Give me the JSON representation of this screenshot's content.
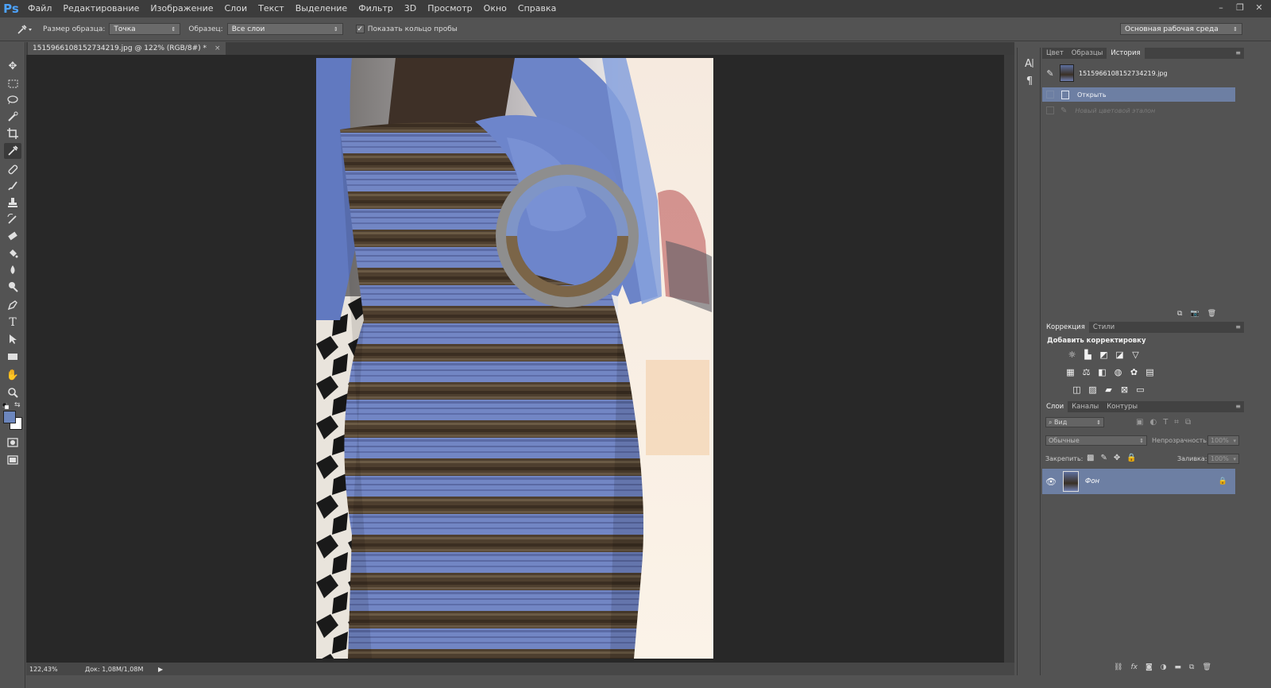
{
  "app": {
    "logo": "Ps",
    "menu": [
      "Файл",
      "Редактирование",
      "Изображение",
      "Слои",
      "Текст",
      "Выделение",
      "Фильтр",
      "3D",
      "Просмотр",
      "Окно",
      "Справка"
    ],
    "window_controls": [
      "–",
      "❐",
      "✕"
    ]
  },
  "options": {
    "sample_size_label": "Размер образца:",
    "sample_size_value": "Точка",
    "sample_label": "Образец:",
    "sample_value": "Все слои",
    "show_ring_label": "Показать кольцо пробы",
    "show_ring_checked": true,
    "workspace": "Основная рабочая среда"
  },
  "document": {
    "tab_title": "1515966108152734219.jpg @ 122% (RGB/8#) *",
    "close": "×"
  },
  "status": {
    "zoom": "122,43%",
    "doc_info": "Док: 1,08M/1,08M"
  },
  "sampler_ring": {
    "top_color": "#7f95c7",
    "bottom_color": "#7b6548",
    "outer_color": "#8e8e8e"
  },
  "panels": {
    "history": {
      "tabs": [
        "Цвет",
        "Образцы",
        "История"
      ],
      "active_tab": "История",
      "snapshot": "1515966108152734219.jpg",
      "steps": [
        {
          "label": "Открыть",
          "state": "active"
        },
        {
          "label": "Новый цветовой эталон",
          "state": "disabled"
        }
      ]
    },
    "adjustments": {
      "tabs": [
        "Коррекция",
        "Стили"
      ],
      "active_tab": "Коррекция",
      "title": "Добавить корректировку"
    },
    "layers": {
      "tabs": [
        "Слои",
        "Каналы",
        "Контуры"
      ],
      "active_tab": "Слои",
      "filter_kind": "Вид",
      "blend_mode": "Обычные",
      "opacity_label": "Непрозрачность:",
      "opacity_value": "100%",
      "lock_label": "Закрепить:",
      "fill_label": "Заливка:",
      "fill_value": "100%",
      "layer_name": "Фон"
    }
  },
  "colors": {
    "foreground": "#6c86bd",
    "background": "#ffffff",
    "selection": "#6d7fa3"
  }
}
